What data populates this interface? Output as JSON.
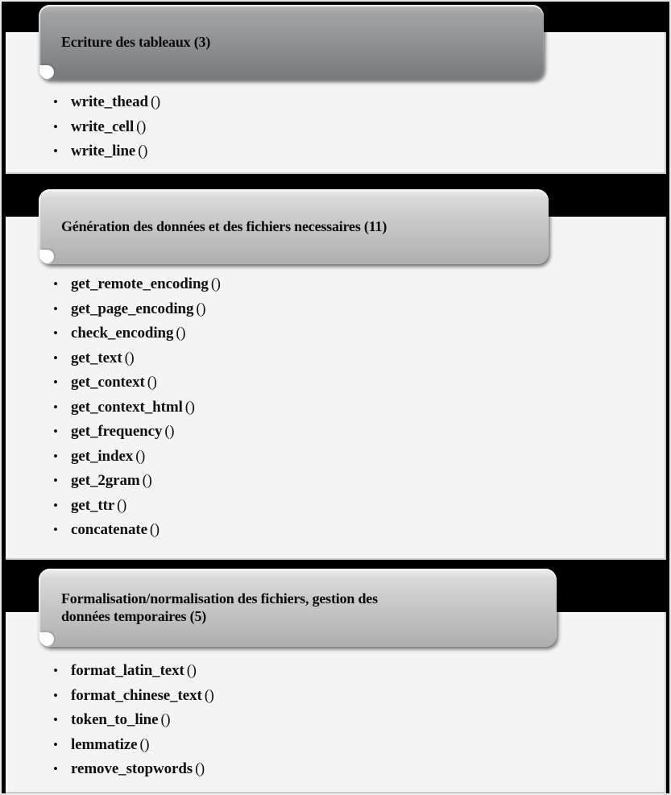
{
  "slide": {
    "background_color": "#000000",
    "panel_body_color": "#f4f4f4",
    "bullet_glyph": "•",
    "parens": "()"
  },
  "panels": [
    {
      "id": "ecriture-des-tableaux",
      "title": "Ecriture des tableaux (3)",
      "count": 3,
      "header_style": "dark",
      "header_gradient": [
        "#b9babc",
        "#77797d"
      ],
      "functions": [
        "write_thead",
        "write_cell",
        "write_line"
      ]
    },
    {
      "id": "generation-des-donnees",
      "title": "Génération des données et des fichiers necessaires (11)",
      "count": 11,
      "header_style": "light",
      "header_gradient": [
        "#efefef",
        "#adadad"
      ],
      "functions": [
        "get_remote_encoding",
        "get_page_encoding",
        "check_encoding",
        "get_text",
        "get_context",
        "get_context_html",
        "get_frequency",
        "get_index",
        "get_2gram",
        "get_ttr",
        "concatenate"
      ]
    },
    {
      "id": "formalisation-normalisation",
      "title": "Formalisation/normalisation des fichiers, gestion des\ndonnées temporaires (5)",
      "count": 5,
      "header_style": "light",
      "header_gradient": [
        "#efefef",
        "#adadad"
      ],
      "functions": [
        "format_latin_text",
        "format_chinese_text",
        "token_to_line",
        "lemmatize",
        "remove_stopwords"
      ]
    }
  ]
}
